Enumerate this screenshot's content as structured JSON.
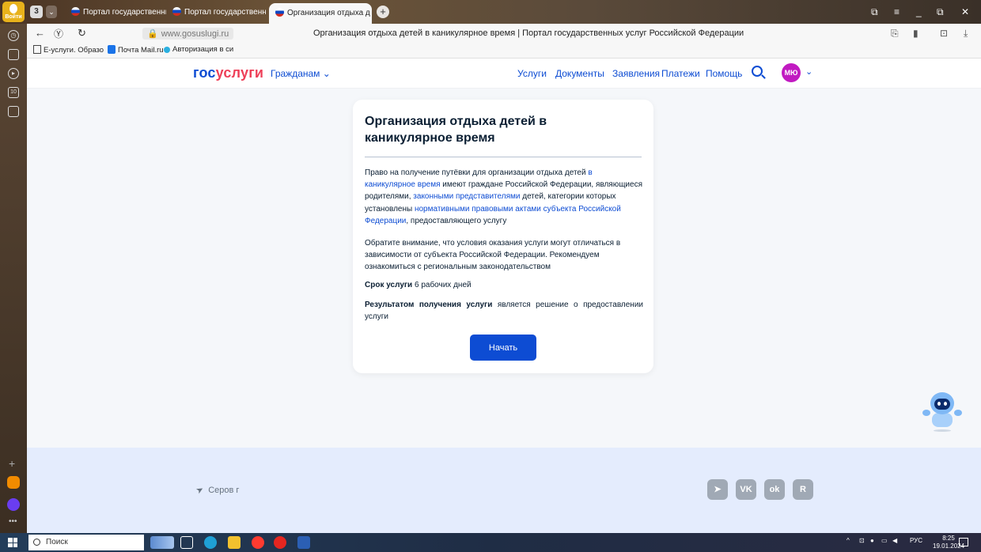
{
  "browser": {
    "login_label": "Войти",
    "tab_count": "3",
    "tabs": [
      {
        "title": "Портал государственных"
      },
      {
        "title": "Портал государственных"
      },
      {
        "title": "Организация отдыха д"
      }
    ],
    "url": "www.gosuslugi.ru",
    "page_title": "Организация отдыха детей в каникулярное время | Портал государственных услуг Российской Федерации",
    "bookmarks": [
      {
        "label": "E-услуги. Образо"
      },
      {
        "label": "Почта Mail.ru"
      },
      {
        "label": "Авторизация в си"
      }
    ],
    "sidebar_badge": "10"
  },
  "site": {
    "logo_part1": "гос",
    "logo_part2": "услуги",
    "citizens_menu": "Гражданам",
    "nav": [
      "Услуги",
      "Документы",
      "Заявления",
      "Платежи",
      "Помощь"
    ],
    "avatar_initials": "МЮ"
  },
  "card": {
    "title": "Организация отдыха детей в каникулярное время",
    "p1_a": "Право на получение путёвки для организации отдыха детей ",
    "p1_link1": "в каникулярное время",
    "p1_b": " имеют граждане Российской Федерации, являющиеся родителями, ",
    "p1_link2": "законными представителями",
    "p1_c": " детей, категории которых установлены ",
    "p1_link3": "нормативными правовыми актами субъекта Российской Федерации",
    "p1_d": ", предоставляющего услугу",
    "p2": "Обратите внимание, что условия оказания услуги могут отличаться в зависимости от субъекта Российской Федерации. Рекомендуем ознакомиться с региональным законодательством",
    "term_label": "Срок услуги",
    "term_value": " 6 рабочих дней",
    "result_label": "Результатом получения услуги",
    "result_value": " является решение о предоставлении услуги",
    "start_button": "Начать"
  },
  "footer": {
    "location": "Серов г",
    "social": [
      "telegram-icon",
      "vk-icon",
      "ok-icon",
      "rutube-icon"
    ]
  },
  "taskbar": {
    "search_placeholder": "Поиск",
    "lang": "РУС",
    "time": "8:25",
    "date": "19.01.2024"
  },
  "colors": {
    "accent": "#0d4cd3",
    "logo_red": "#ee3f58",
    "footer_bg": "#e4ecfd",
    "page_bg": "#f5f7fa"
  }
}
